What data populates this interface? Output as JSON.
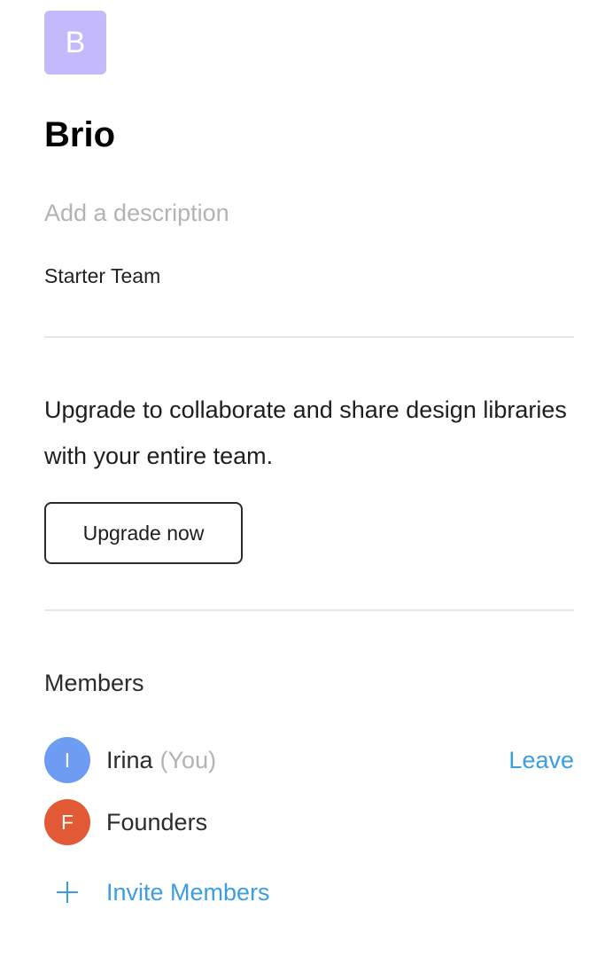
{
  "team": {
    "avatar_letter": "B",
    "avatar_color": "#c4b9fb",
    "name": "Brio",
    "description_placeholder": "Add a description",
    "plan": "Starter Team"
  },
  "upgrade": {
    "message": "Upgrade to collaborate and share design libraries with your entire team.",
    "button_label": "Upgrade now"
  },
  "members": {
    "heading": "Members",
    "items": [
      {
        "initial": "I",
        "name": "Irina",
        "tag": "(You)",
        "action": "Leave",
        "color": "#6d9cf2"
      },
      {
        "initial": "F",
        "name": "Founders",
        "color": "#e25a35"
      }
    ],
    "invite_label": "Invite Members",
    "invite_icon": "plus-icon"
  },
  "colors": {
    "link": "#3b9ee0",
    "muted": "#b3b3b3",
    "divider": "#e6e6e6"
  }
}
